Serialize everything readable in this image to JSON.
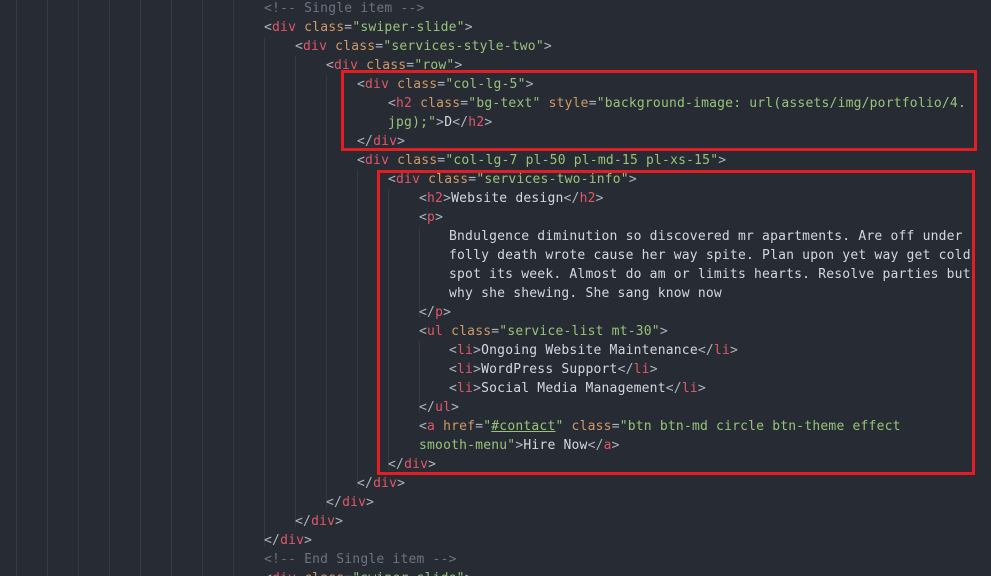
{
  "editor": {
    "lines": [
      {
        "indent": 264,
        "tokens": [
          {
            "k": "c",
            "v": "<!-- Single item -->"
          }
        ]
      },
      {
        "indent": 264,
        "tokens": [
          {
            "k": "p",
            "v": "<"
          },
          {
            "k": "t",
            "v": "div"
          },
          {
            "k": "x",
            "v": " "
          },
          {
            "k": "a",
            "v": "class"
          },
          {
            "k": "p",
            "v": "="
          },
          {
            "k": "s",
            "v": "\"swiper-slide\""
          },
          {
            "k": "p",
            "v": ">"
          }
        ]
      },
      {
        "indent": 295,
        "tokens": [
          {
            "k": "p",
            "v": "<"
          },
          {
            "k": "t",
            "v": "div"
          },
          {
            "k": "x",
            "v": " "
          },
          {
            "k": "a",
            "v": "class"
          },
          {
            "k": "p",
            "v": "="
          },
          {
            "k": "s",
            "v": "\"services-style-two\""
          },
          {
            "k": "p",
            "v": ">"
          }
        ]
      },
      {
        "indent": 326,
        "tokens": [
          {
            "k": "p",
            "v": "<"
          },
          {
            "k": "t",
            "v": "div"
          },
          {
            "k": "x",
            "v": " "
          },
          {
            "k": "a",
            "v": "class"
          },
          {
            "k": "p",
            "v": "="
          },
          {
            "k": "s",
            "v": "\"row\""
          },
          {
            "k": "p",
            "v": ">"
          }
        ]
      },
      {
        "indent": 357,
        "tokens": [
          {
            "k": "p",
            "v": "<"
          },
          {
            "k": "t",
            "v": "div"
          },
          {
            "k": "x",
            "v": " "
          },
          {
            "k": "a",
            "v": "class"
          },
          {
            "k": "p",
            "v": "="
          },
          {
            "k": "s",
            "v": "\"col-lg-5\""
          },
          {
            "k": "p",
            "v": ">"
          }
        ]
      },
      {
        "indent": 388,
        "tokens": [
          {
            "k": "p",
            "v": "<"
          },
          {
            "k": "t",
            "v": "h2"
          },
          {
            "k": "x",
            "v": " "
          },
          {
            "k": "a",
            "v": "class"
          },
          {
            "k": "p",
            "v": "="
          },
          {
            "k": "s",
            "v": "\"bg-text\""
          },
          {
            "k": "x",
            "v": " "
          },
          {
            "k": "a",
            "v": "style"
          },
          {
            "k": "p",
            "v": "="
          },
          {
            "k": "s",
            "v": "\"background-image: url(assets/img/portfolio/4."
          }
        ]
      },
      {
        "indent": 388,
        "tokens": [
          {
            "k": "s",
            "v": "jpg);\""
          },
          {
            "k": "p",
            "v": ">"
          },
          {
            "k": "x",
            "v": "D"
          },
          {
            "k": "p",
            "v": "</"
          },
          {
            "k": "t",
            "v": "h2"
          },
          {
            "k": "p",
            "v": ">"
          }
        ]
      },
      {
        "indent": 357,
        "tokens": [
          {
            "k": "p",
            "v": "</"
          },
          {
            "k": "t",
            "v": "div"
          },
          {
            "k": "p",
            "v": ">"
          }
        ]
      },
      {
        "indent": 357,
        "tokens": [
          {
            "k": "p",
            "v": "<"
          },
          {
            "k": "t",
            "v": "div"
          },
          {
            "k": "x",
            "v": " "
          },
          {
            "k": "a",
            "v": "class"
          },
          {
            "k": "p",
            "v": "="
          },
          {
            "k": "s",
            "v": "\"col-lg-7 pl-50 pl-md-15 pl-xs-15\""
          },
          {
            "k": "p",
            "v": ">"
          }
        ]
      },
      {
        "indent": 388,
        "tokens": [
          {
            "k": "p",
            "v": "<"
          },
          {
            "k": "t",
            "v": "div"
          },
          {
            "k": "x",
            "v": " "
          },
          {
            "k": "a",
            "v": "class"
          },
          {
            "k": "p",
            "v": "="
          },
          {
            "k": "s",
            "v": "\"services-two-info\""
          },
          {
            "k": "p",
            "v": ">"
          }
        ]
      },
      {
        "indent": 419,
        "tokens": [
          {
            "k": "p",
            "v": "<"
          },
          {
            "k": "t",
            "v": "h2"
          },
          {
            "k": "p",
            "v": ">"
          },
          {
            "k": "x",
            "v": "Website design"
          },
          {
            "k": "p",
            "v": "</"
          },
          {
            "k": "t",
            "v": "h2"
          },
          {
            "k": "p",
            "v": ">"
          }
        ]
      },
      {
        "indent": 419,
        "tokens": [
          {
            "k": "p",
            "v": "<"
          },
          {
            "k": "t",
            "v": "p"
          },
          {
            "k": "p",
            "v": ">"
          }
        ]
      },
      {
        "indent": 449,
        "tokens": [
          {
            "k": "x",
            "v": "Bndulgence diminution so discovered mr apartments. Are off under"
          }
        ]
      },
      {
        "indent": 449,
        "tokens": [
          {
            "k": "x",
            "v": "folly death wrote cause her way spite. Plan upon yet way get cold"
          }
        ]
      },
      {
        "indent": 449,
        "tokens": [
          {
            "k": "x",
            "v": "spot its week. Almost do am or limits hearts. Resolve parties but"
          }
        ]
      },
      {
        "indent": 449,
        "tokens": [
          {
            "k": "x",
            "v": "why she shewing. She sang know now"
          }
        ]
      },
      {
        "indent": 419,
        "tokens": [
          {
            "k": "p",
            "v": "</"
          },
          {
            "k": "t",
            "v": "p"
          },
          {
            "k": "p",
            "v": ">"
          }
        ]
      },
      {
        "indent": 419,
        "tokens": [
          {
            "k": "p",
            "v": "<"
          },
          {
            "k": "t",
            "v": "ul"
          },
          {
            "k": "x",
            "v": " "
          },
          {
            "k": "a",
            "v": "class"
          },
          {
            "k": "p",
            "v": "="
          },
          {
            "k": "s",
            "v": "\"service-list mt-30\""
          },
          {
            "k": "p",
            "v": ">"
          }
        ]
      },
      {
        "indent": 449,
        "tokens": [
          {
            "k": "p",
            "v": "<"
          },
          {
            "k": "t",
            "v": "li"
          },
          {
            "k": "p",
            "v": ">"
          },
          {
            "k": "x",
            "v": "Ongoing Website Maintenance"
          },
          {
            "k": "p",
            "v": "</"
          },
          {
            "k": "t",
            "v": "li"
          },
          {
            "k": "p",
            "v": ">"
          }
        ]
      },
      {
        "indent": 449,
        "tokens": [
          {
            "k": "p",
            "v": "<"
          },
          {
            "k": "t",
            "v": "li"
          },
          {
            "k": "p",
            "v": ">"
          },
          {
            "k": "x",
            "v": "WordPress Support"
          },
          {
            "k": "p",
            "v": "</"
          },
          {
            "k": "t",
            "v": "li"
          },
          {
            "k": "p",
            "v": ">"
          }
        ]
      },
      {
        "indent": 449,
        "tokens": [
          {
            "k": "p",
            "v": "<"
          },
          {
            "k": "t",
            "v": "li"
          },
          {
            "k": "p",
            "v": ">"
          },
          {
            "k": "x",
            "v": "Social Media Management"
          },
          {
            "k": "p",
            "v": "</"
          },
          {
            "k": "t",
            "v": "li"
          },
          {
            "k": "p",
            "v": ">"
          }
        ]
      },
      {
        "indent": 419,
        "tokens": [
          {
            "k": "p",
            "v": "</"
          },
          {
            "k": "t",
            "v": "ul"
          },
          {
            "k": "p",
            "v": ">"
          }
        ]
      },
      {
        "indent": 419,
        "tokens": [
          {
            "k": "p",
            "v": "<"
          },
          {
            "k": "t",
            "v": "a"
          },
          {
            "k": "x",
            "v": " "
          },
          {
            "k": "a",
            "v": "href"
          },
          {
            "k": "p",
            "v": "="
          },
          {
            "k": "s",
            "v": "\""
          },
          {
            "k": "su",
            "v": "#contact"
          },
          {
            "k": "s",
            "v": "\""
          },
          {
            "k": "x",
            "v": " "
          },
          {
            "k": "a",
            "v": "class"
          },
          {
            "k": "p",
            "v": "="
          },
          {
            "k": "s",
            "v": "\"btn btn-md circle btn-theme effect"
          }
        ]
      },
      {
        "indent": 419,
        "tokens": [
          {
            "k": "s",
            "v": "smooth-menu\""
          },
          {
            "k": "p",
            "v": ">"
          },
          {
            "k": "x",
            "v": "Hire Now"
          },
          {
            "k": "p",
            "v": "</"
          },
          {
            "k": "t",
            "v": "a"
          },
          {
            "k": "p",
            "v": ">"
          }
        ]
      },
      {
        "indent": 388,
        "tokens": [
          {
            "k": "p",
            "v": "</"
          },
          {
            "k": "t",
            "v": "div"
          },
          {
            "k": "p",
            "v": ">"
          }
        ]
      },
      {
        "indent": 357,
        "tokens": [
          {
            "k": "p",
            "v": "</"
          },
          {
            "k": "t",
            "v": "div"
          },
          {
            "k": "p",
            "v": ">"
          }
        ]
      },
      {
        "indent": 326,
        "tokens": [
          {
            "k": "p",
            "v": "</"
          },
          {
            "k": "t",
            "v": "div"
          },
          {
            "k": "p",
            "v": ">"
          }
        ]
      },
      {
        "indent": 295,
        "tokens": [
          {
            "k": "p",
            "v": "</"
          },
          {
            "k": "t",
            "v": "div"
          },
          {
            "k": "p",
            "v": ">"
          }
        ]
      },
      {
        "indent": 264,
        "tokens": [
          {
            "k": "p",
            "v": "</"
          },
          {
            "k": "t",
            "v": "div"
          },
          {
            "k": "p",
            "v": ">"
          }
        ]
      },
      {
        "indent": 264,
        "tokens": [
          {
            "k": "c",
            "v": "<!-- End Single item -->"
          }
        ]
      },
      {
        "indent": 264,
        "tokens": [
          {
            "k": "p",
            "v": "<"
          },
          {
            "k": "t",
            "v": "div"
          },
          {
            "k": "x",
            "v": " "
          },
          {
            "k": "a",
            "v": "class"
          },
          {
            "k": "p",
            "v": "="
          },
          {
            "k": "s",
            "v": "\"swiper-slide\""
          },
          {
            "k": "p",
            "v": ">"
          }
        ]
      }
    ]
  },
  "colors": {
    "background": "#272b33",
    "highlight_border": "#e41c24",
    "tag": "#e0576a",
    "attribute": "#d19a66",
    "string": "#98c379",
    "comment": "#6b7482"
  }
}
